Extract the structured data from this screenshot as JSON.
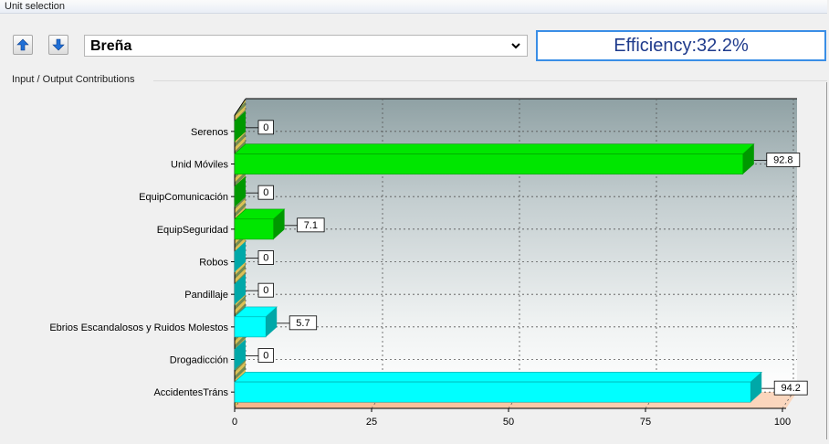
{
  "unit_selection": {
    "header": "Unit selection",
    "selected_unit": "Breña",
    "efficiency_label": "Efficiency:32.2%",
    "prev_icon": "arrow-up-icon",
    "next_icon": "arrow-down-icon"
  },
  "contributions": {
    "label": "Input / Output Contributions"
  },
  "chart_data": {
    "type": "bar",
    "orientation": "horizontal",
    "categories": [
      "Serenos",
      "Unid Móviles",
      "EquipComunicación",
      "EquipSeguridad",
      "Robos",
      "Pandillaje",
      "Ebrios Escandalosos y Ruidos Molestos",
      "Drogadicción",
      "AccidentesTráns"
    ],
    "values": [
      0,
      92.8,
      0,
      7.1,
      0,
      0,
      5.7,
      0,
      94.2
    ],
    "value_labels": [
      "0",
      "92.8",
      "0",
      "7.1",
      "0",
      "0",
      "5.7",
      "0",
      "94.2"
    ],
    "group": [
      "input",
      "input",
      "input",
      "input",
      "output",
      "output",
      "output",
      "output",
      "output"
    ],
    "colors": {
      "input": "#00e600",
      "output": "#00ffff",
      "input_dark": "#009900",
      "output_dark": "#00a8a8"
    },
    "xlim": [
      0,
      100
    ],
    "xticks": [
      "0",
      "25",
      "50",
      "75",
      "100"
    ],
    "grid": true
  }
}
